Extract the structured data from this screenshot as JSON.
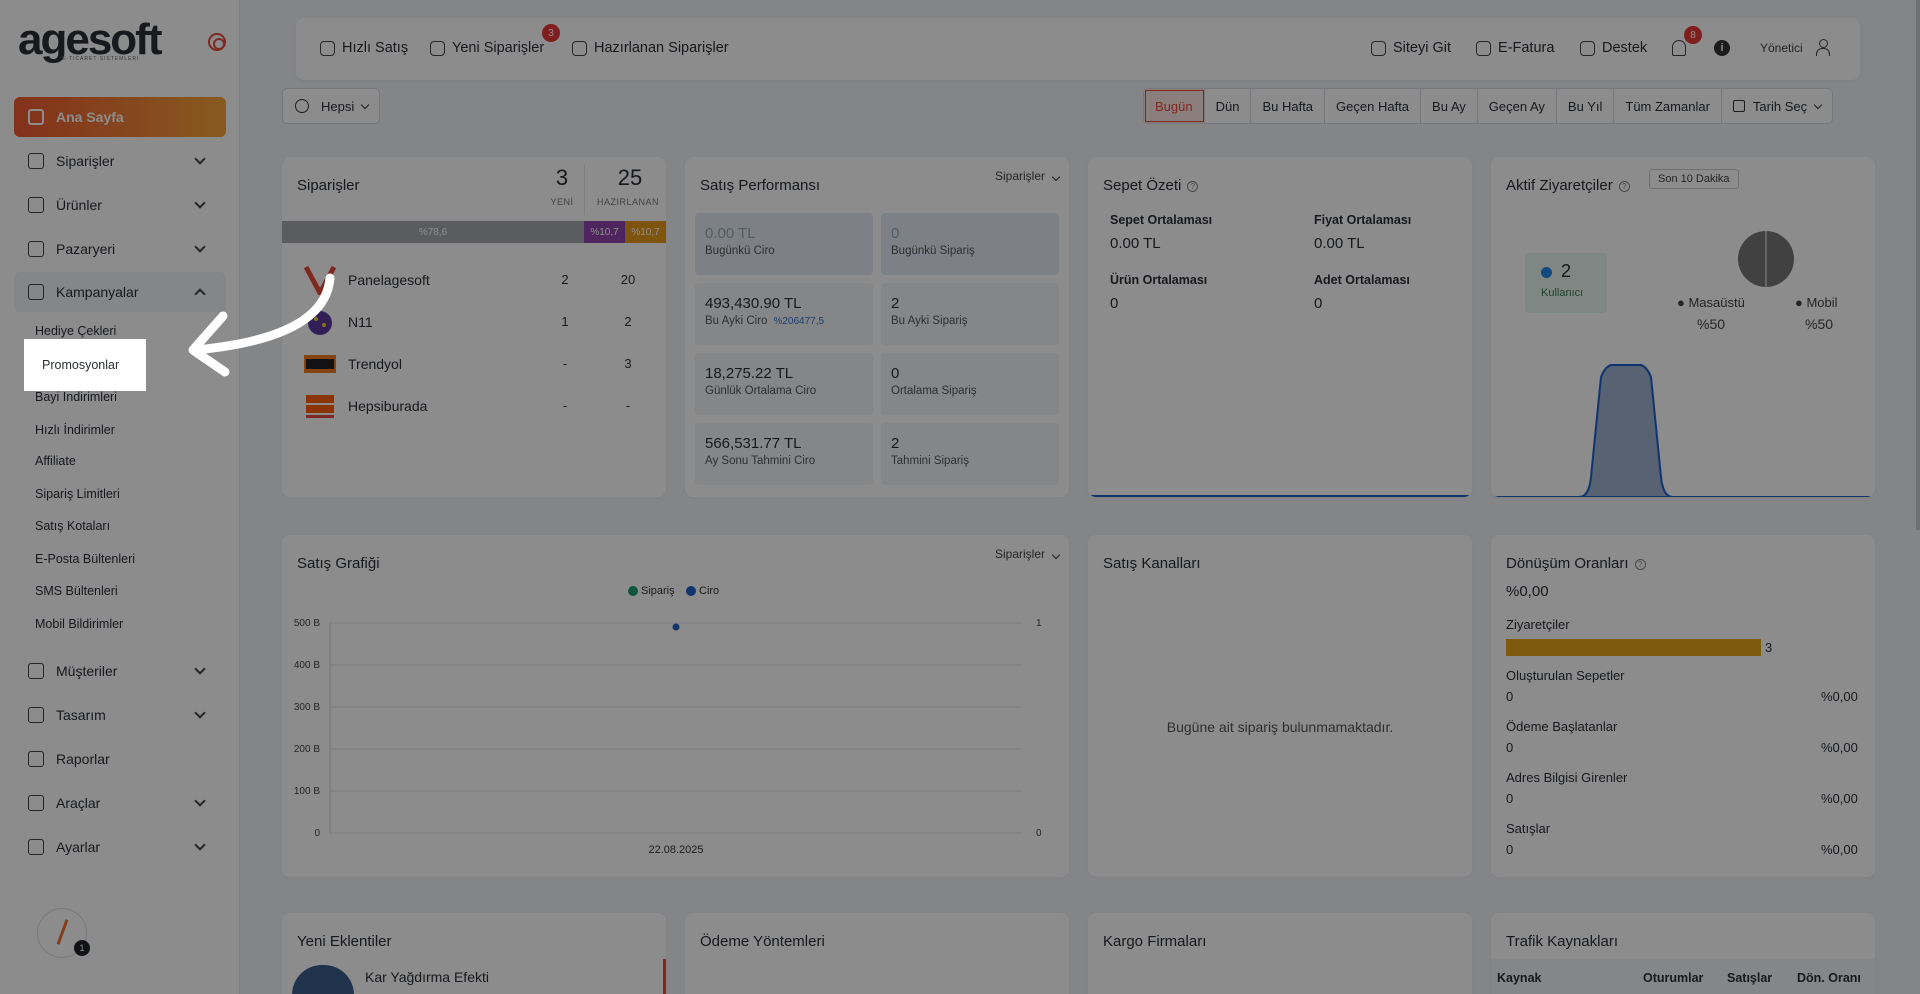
{
  "brand": {
    "name": "agesoft",
    "tagline": "E-TICARET SISTEMLERI"
  },
  "sidebar": {
    "main": "Ana Sayfa",
    "items": [
      {
        "label": "Siparişler",
        "icon": "cart-icon"
      },
      {
        "label": "Ürünler",
        "icon": "book-icon"
      },
      {
        "label": "Pazaryeri",
        "icon": "cloud-icon"
      },
      {
        "label": "Kampanyalar",
        "icon": "gift-icon"
      },
      {
        "label": "Müşteriler",
        "icon": "user-icon"
      },
      {
        "label": "Tasarım",
        "icon": "edit-icon"
      },
      {
        "label": "Raporlar",
        "icon": "chart-icon"
      },
      {
        "label": "Araçlar",
        "icon": "clipboard-icon"
      },
      {
        "label": "Ayarlar",
        "icon": "settings-icon"
      }
    ],
    "submenu": [
      "Hediye Çekleri",
      "Promosyonlar",
      "Bayi İndirimleri",
      "Hızlı İndirimler",
      "Affiliate",
      "Sipariş Limitleri",
      "Satış Kotaları",
      "E-Posta Bültenleri",
      "SMS Bültenleri",
      "Mobil Bildirimler"
    ],
    "avatar_badge": "1"
  },
  "topbar": {
    "hizli_satis": "Hızlı Satış",
    "yeni_siparisler": "Yeni Siparişler",
    "yeni_badge": "3",
    "hazirlanan": "Hazırlanan Siparişler",
    "siteyi_git": "Siteyi Git",
    "efatura": "E-Fatura",
    "destek": "Destek",
    "bell_badge": "8",
    "info": "i",
    "user": "Yönetici"
  },
  "filter": {
    "scope": "Hepsi",
    "periods": [
      "Bugün",
      "Dün",
      "Bu Hafta",
      "Geçen Hafta",
      "Bu Ay",
      "Geçen Ay",
      "Bu Yıl",
      "Tüm Zamanlar"
    ],
    "active_period": "Bugün",
    "date_select": "Tarih Seç"
  },
  "orders": {
    "title": "Siparişler",
    "new_count": "3",
    "new_label": "YENİ",
    "prep_count": "25",
    "prep_label": "HAZIRLANAN",
    "bars": [
      {
        "label": "%78,6",
        "color": "#a5a8ad"
      },
      {
        "label": "%10,7",
        "color": "#8e44ad"
      },
      {
        "label": "%10,7",
        "color": "#e59a1b"
      }
    ],
    "channels": [
      {
        "name": "Panelagesoft",
        "new": "2",
        "prep": "20"
      },
      {
        "name": "N11",
        "new": "1",
        "prep": "2"
      },
      {
        "name": "Trendyol",
        "new": "-",
        "prep": "3"
      },
      {
        "name": "Hepsiburada",
        "new": "-",
        "prep": "-"
      }
    ]
  },
  "performance": {
    "title": "Satış Performansı",
    "selector": "Siparişler",
    "cells": [
      {
        "value": "0.00 TL",
        "label": "Bugünkü Ciro"
      },
      {
        "value": "0",
        "label": "Bugünkü Sipariş"
      },
      {
        "value": "493,430.90 TL",
        "label": "Bu Ayki Ciro",
        "pct": "%206477,5"
      },
      {
        "value": "2",
        "label": "Bu Ayki Sipariş"
      },
      {
        "value": "18,275.22 TL",
        "label": "Günlük Ortalama Ciro"
      },
      {
        "value": "0",
        "label": "Ortalama Sipariş"
      },
      {
        "value": "566,531.77 TL",
        "label": "Ay Sonu Tahmini Ciro"
      },
      {
        "value": "2",
        "label": "Tahmini Sipariş"
      }
    ]
  },
  "basket": {
    "title": "Sepet Özeti",
    "items": [
      {
        "label": "Sepet Ortalaması",
        "value": "0.00 TL"
      },
      {
        "label": "Fiyat Ortalaması",
        "value": "0.00 TL"
      },
      {
        "label": "Ürün Ortalaması",
        "value": "0"
      },
      {
        "label": "Adet Ortalaması",
        "value": "0"
      }
    ]
  },
  "visitors": {
    "title": "Aktif Ziyaretçiler",
    "period": "Son 10 Dakika",
    "count": "2",
    "count_label": "Kullanıcı",
    "desktop_label": "Masaüstü",
    "desktop_pct": "%50",
    "mobile_label": "Mobil",
    "mobile_pct": "%50"
  },
  "sales_chart": {
    "title": "Satış Grafiği",
    "selector": "Siparişler",
    "empty": "Bugüne ait sipariş bulunmamaktadır."
  },
  "chart_data": {
    "type": "line",
    "title": "",
    "x": [
      "22.08.2025"
    ],
    "series": [
      {
        "name": "Sipariş",
        "values": [
          0
        ],
        "color": "#1a9e6e"
      },
      {
        "name": "Ciro",
        "values": [
          500
        ],
        "color": "#1e5fc8"
      }
    ],
    "y_ticks_left": [
      "500 B",
      "400 B",
      "300 B",
      "200 B",
      "100 B",
      "0"
    ],
    "y_ticks_right": [
      "1",
      "0"
    ],
    "ylim": [
      0,
      500
    ]
  },
  "channels_card": {
    "title": "Satış Kanalları",
    "empty": "Bugüne ait sipariş bulunmamaktadır."
  },
  "conversion": {
    "title": "Dönüşüm Oranları",
    "rate": "%0,00",
    "rows": [
      {
        "label": "Ziyaretçiler",
        "value": "3",
        "bar_fraction": 1.0
      },
      {
        "label": "Oluşturulan Sepetler",
        "value": "0",
        "pct": "%0,00"
      },
      {
        "label": "Ödeme Başlatanlar",
        "value": "0",
        "pct": "%0,00"
      },
      {
        "label": "Adres Bilgisi Girenler",
        "value": "0",
        "pct": "%0,00"
      },
      {
        "label": "Satışlar",
        "value": "0",
        "pct": "%0,00"
      }
    ]
  },
  "bottom": {
    "new_plugins": "Yeni Eklentiler",
    "plugin_name": "Kar Yağdırma Efekti",
    "payment": "Ödeme Yöntemleri",
    "cargo": "Kargo Firmaları",
    "traffic": "Trafik Kaynakları",
    "traffic_headers": [
      "Kaynak",
      "Oturumlar",
      "Satışlar",
      "Dön. Oranı"
    ]
  }
}
